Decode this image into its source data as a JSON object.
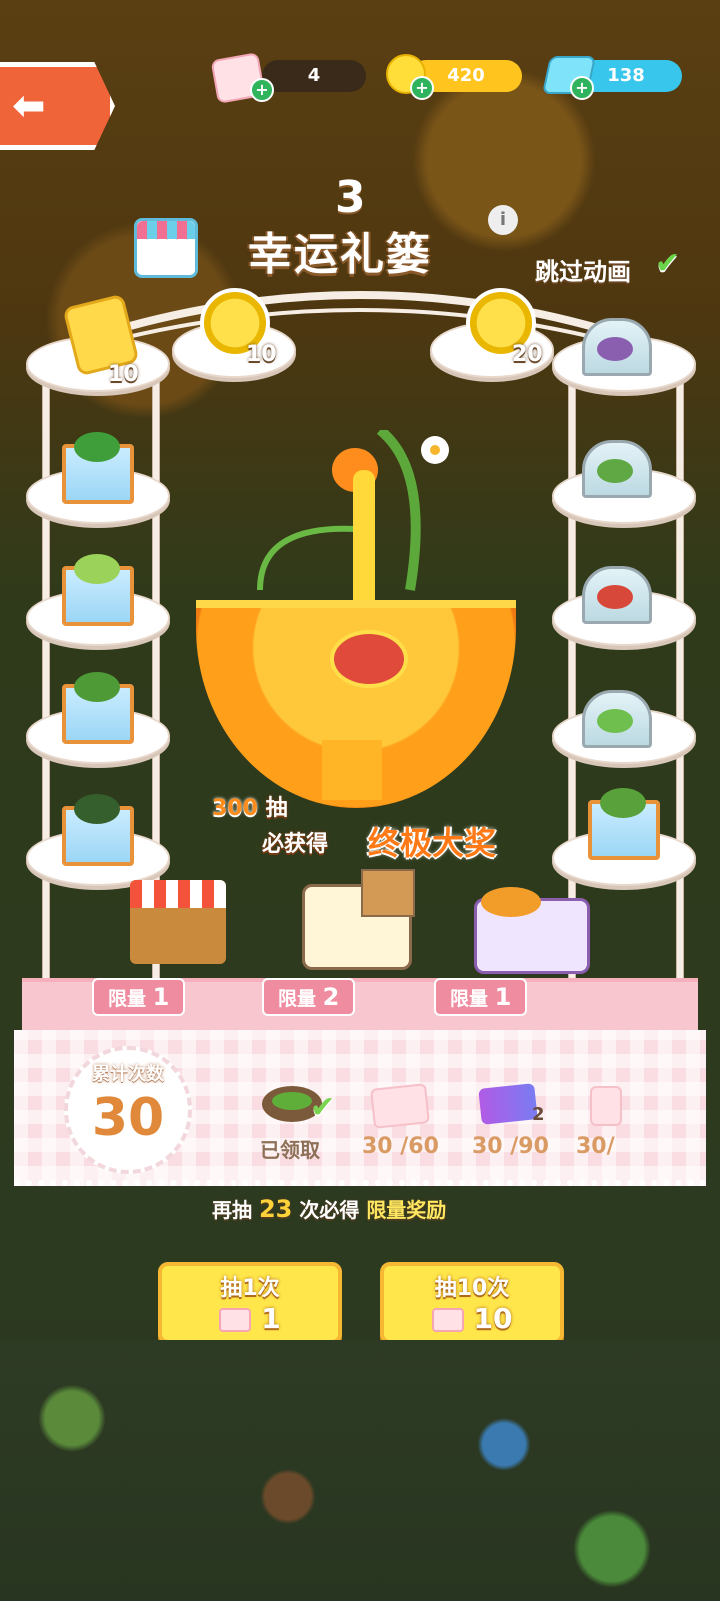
{
  "topbar": {
    "tickets": "4",
    "coins": "420",
    "gems": "138"
  },
  "title": {
    "number": "3",
    "text": "幸运礼篓",
    "skip_label": "跳过动画"
  },
  "shelf": {
    "top_items": [
      {
        "icon": "seed-bag-icon",
        "count": "10"
      },
      {
        "icon": "coin-icon",
        "count": "10"
      },
      {
        "icon": "coin-icon",
        "count": "20"
      }
    ]
  },
  "promo": {
    "draws": "300",
    "draws_suffix": "抽",
    "guarantee": "必获得",
    "grand_prize": "终极大奖"
  },
  "limits": [
    {
      "label": "限量",
      "value": "1"
    },
    {
      "label": "限量",
      "value": "2"
    },
    {
      "label": "限量",
      "value": "1"
    }
  ],
  "counter": {
    "label": "累计次数",
    "value": "30"
  },
  "milestones": [
    {
      "text": "已领取"
    },
    {
      "text": "30 /60"
    },
    {
      "text": "30 /90",
      "badge": "2"
    },
    {
      "text": "30/"
    }
  ],
  "hint": {
    "prefix": "再抽",
    "count": "23",
    "middle": "次必得",
    "reward": "限量奖励"
  },
  "buttons": {
    "draw1": {
      "label": "抽1次",
      "cost": "1"
    },
    "draw10": {
      "label": "抽10次",
      "cost": "10"
    }
  },
  "colors": {
    "accent": "#ffe64a",
    "pink": "#f8c6cf",
    "orange": "#ff8d1e"
  }
}
